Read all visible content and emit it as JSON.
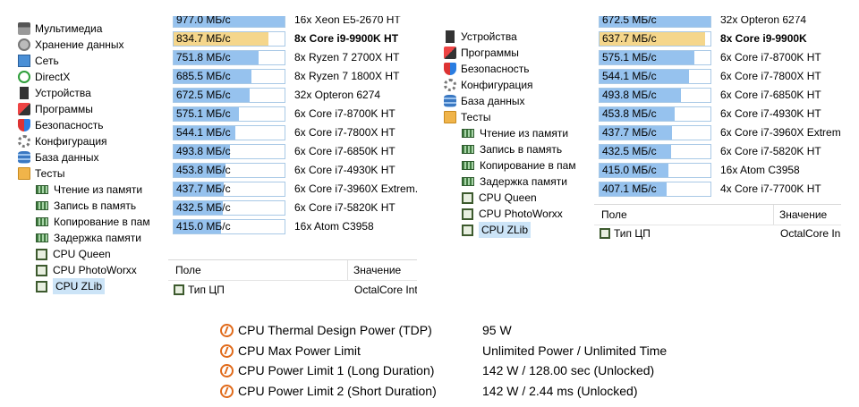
{
  "left_tree": {
    "items": [
      {
        "label": "Мультимедиа",
        "icon": "multimedia-icon"
      },
      {
        "label": "Хранение данных",
        "icon": "storage-icon"
      },
      {
        "label": "Сеть",
        "icon": "network-icon"
      },
      {
        "label": "DirectX",
        "icon": "directx-icon"
      },
      {
        "label": "Устройства",
        "icon": "devices-icon"
      },
      {
        "label": "Программы",
        "icon": "programs-icon"
      },
      {
        "label": "Безопасность",
        "icon": "security-icon"
      },
      {
        "label": "Конфигурация",
        "icon": "config-icon"
      },
      {
        "label": "База данных",
        "icon": "database-icon"
      },
      {
        "label": "Тесты",
        "icon": "tests-icon"
      },
      {
        "label": "Чтение из памяти",
        "icon": "ram-icon"
      },
      {
        "label": "Запись в память",
        "icon": "ram-icon"
      },
      {
        "label": "Копирование в пам",
        "icon": "ram-icon"
      },
      {
        "label": "Задержка памяти",
        "icon": "ram-icon"
      },
      {
        "label": "CPU Queen",
        "icon": "cpu-icon"
      },
      {
        "label": "CPU PhotoWorxx",
        "icon": "cpu-icon"
      },
      {
        "label": "CPU ZLib",
        "icon": "cpu-icon",
        "selected": true
      }
    ]
  },
  "left_results": {
    "rows": [
      {
        "value": "977.0 МБ/с",
        "cpu": "16x Xeon E5-2670 HT",
        "fill": 1.0
      },
      {
        "value": "834.7 МБ/с",
        "cpu": "8x Core i9-9900K HT",
        "fill": 0.854,
        "highlight": true
      },
      {
        "value": "751.8 МБ/с",
        "cpu": "8x Ryzen 7 2700X HT",
        "fill": 0.77
      },
      {
        "value": "685.5 МБ/с",
        "cpu": "8x Ryzen 7 1800X HT",
        "fill": 0.7
      },
      {
        "value": "672.5 МБ/с",
        "cpu": "32x Opteron 6274",
        "fill": 0.688
      },
      {
        "value": "575.1 МБ/с",
        "cpu": "6x Core i7-8700K HT",
        "fill": 0.59
      },
      {
        "value": "544.1 МБ/с",
        "cpu": "6x Core i7-7800X HT",
        "fill": 0.557
      },
      {
        "value": "493.8 МБ/с",
        "cpu": "6x Core i7-6850K HT",
        "fill": 0.505
      },
      {
        "value": "453.8 МБ/с",
        "cpu": "6x Core i7-4930K HT",
        "fill": 0.464
      },
      {
        "value": "437.7 МБ/с",
        "cpu": "6x Core i7-3960X Extrem...",
        "fill": 0.448
      },
      {
        "value": "432.5 МБ/с",
        "cpu": "6x Core i7-5820K HT",
        "fill": 0.443
      },
      {
        "value": "415.0 МБ/с",
        "cpu": "16x Atom C3958",
        "fill": 0.425
      }
    ],
    "header": {
      "field": "Поле",
      "value": "Значение"
    },
    "prop_row": {
      "field": "Тип ЦП",
      "value": "OctalCore Int"
    }
  },
  "right_tree": {
    "items": [
      {
        "label": "Устройства",
        "icon": "devices-icon"
      },
      {
        "label": "Программы",
        "icon": "programs-icon"
      },
      {
        "label": "Безопасность",
        "icon": "security-icon"
      },
      {
        "label": "Конфигурация",
        "icon": "config-icon"
      },
      {
        "label": "База данных",
        "icon": "database-icon"
      },
      {
        "label": "Тесты",
        "icon": "tests-icon"
      },
      {
        "label": "Чтение из памяти",
        "icon": "ram-icon"
      },
      {
        "label": "Запись в память",
        "icon": "ram-icon"
      },
      {
        "label": "Копирование в пам",
        "icon": "ram-icon"
      },
      {
        "label": "Задержка памяти",
        "icon": "ram-icon"
      },
      {
        "label": "CPU Queen",
        "icon": "cpu-icon"
      },
      {
        "label": "CPU PhotoWorxx",
        "icon": "cpu-icon"
      },
      {
        "label": "CPU ZLib",
        "icon": "cpu-icon",
        "selected": true
      }
    ]
  },
  "right_results": {
    "rows": [
      {
        "value": "672.5 МБ/с",
        "cpu": "32x Opteron 6274",
        "fill": 1.0
      },
      {
        "value": "637.7 МБ/с",
        "cpu": "8x Core i9-9900K",
        "fill": 0.948,
        "highlight": true
      },
      {
        "value": "575.1 МБ/с",
        "cpu": "6x Core i7-8700K HT",
        "fill": 0.855
      },
      {
        "value": "544.1 МБ/с",
        "cpu": "6x Core i7-7800X HT",
        "fill": 0.809
      },
      {
        "value": "493.8 МБ/с",
        "cpu": "6x Core i7-6850K HT",
        "fill": 0.734
      },
      {
        "value": "453.8 МБ/с",
        "cpu": "6x Core i7-4930K HT",
        "fill": 0.675
      },
      {
        "value": "437.7 МБ/с",
        "cpu": "6x Core i7-3960X Extrem...",
        "fill": 0.651
      },
      {
        "value": "432.5 МБ/с",
        "cpu": "6x Core i7-5820K HT",
        "fill": 0.643
      },
      {
        "value": "415.0 МБ/с",
        "cpu": "16x Atom C3958",
        "fill": 0.617
      },
      {
        "value": "407.1 МБ/с",
        "cpu": "4x Core i7-7700K HT",
        "fill": 0.605
      }
    ],
    "header": {
      "field": "Поле",
      "value": "Значение"
    },
    "prop_row": {
      "field": "Тип ЦП",
      "value": "OctalCore In"
    }
  },
  "power": {
    "rows": [
      {
        "label": "CPU Thermal Design Power (TDP)",
        "value": "95 W"
      },
      {
        "label": "CPU Max Power Limit",
        "value": "Unlimited Power / Unlimited Time"
      },
      {
        "label": "CPU Power Limit 1 (Long Duration)",
        "value": "142 W / 128.00 sec  (Unlocked)"
      },
      {
        "label": "CPU Power Limit 2 (Short Duration)",
        "value": "142 W / 2.44 ms  (Unlocked)"
      }
    ]
  },
  "colors": {
    "bar": "#96c2ee",
    "highlight": "#f5d68b",
    "selection": "#cde8ff",
    "power_icon": "#e06a1a"
  }
}
